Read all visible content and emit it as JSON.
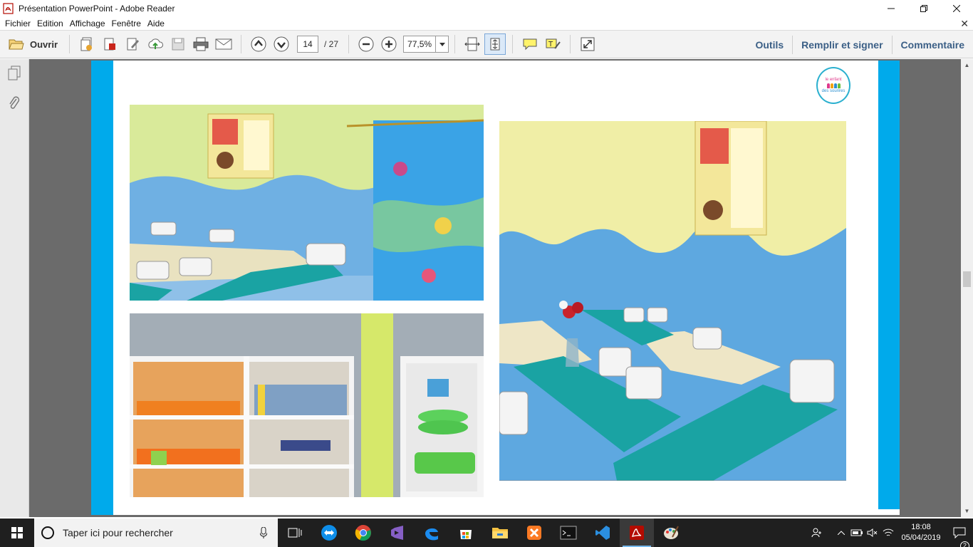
{
  "window": {
    "title": "Présentation PowerPoint - Adobe Reader"
  },
  "menu": {
    "items": [
      {
        "label": "Fichier",
        "key": "F"
      },
      {
        "label": "Edition",
        "key": "E"
      },
      {
        "label": "Affichage",
        "key": "A"
      },
      {
        "label": "Fenêtre",
        "key": "n"
      },
      {
        "label": "Aide",
        "key": "i"
      }
    ]
  },
  "toolbar": {
    "open_label": "Ouvrir",
    "current_page": "14",
    "total_pages": "/ 27",
    "zoom": "77,5%",
    "right_links": {
      "tools": "Outils",
      "fill_sign": "Remplir et signer",
      "comment": "Commentaire"
    }
  },
  "slide": {
    "logo_line1": "le enfant",
    "logo_line2": "des sourires"
  },
  "taskbar": {
    "search_placeholder": "Taper ici pour rechercher",
    "time": "18:08",
    "date": "05/04/2019",
    "notification_count": "2"
  },
  "colors": {
    "accent_blue": "#00aaeb",
    "toolbar_link": "#3b5f86",
    "wall_blue": "#5fa9e0",
    "wall_yellow": "#e8f0a8",
    "table_teal": "#1aa3a3",
    "taskbar": "#1f1f1f"
  }
}
